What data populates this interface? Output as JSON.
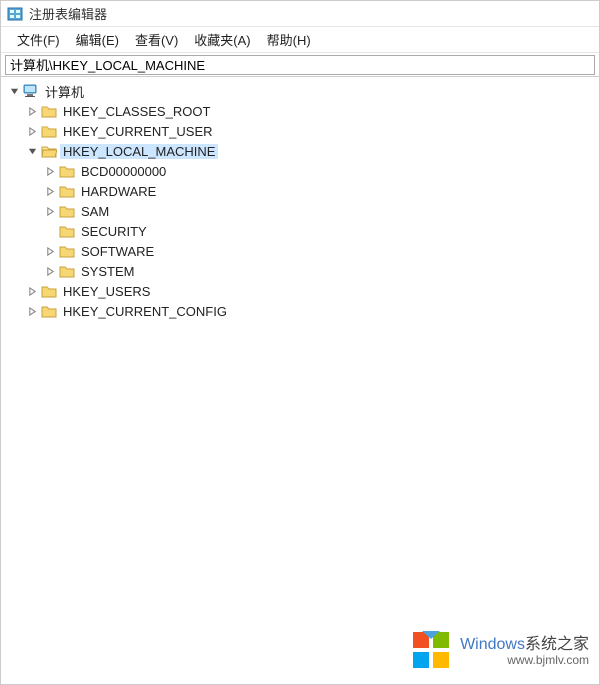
{
  "window": {
    "title": "注册表编辑器"
  },
  "menu": {
    "file": "文件(F)",
    "edit": "编辑(E)",
    "view": "查看(V)",
    "favorites": "收藏夹(A)",
    "help": "帮助(H)"
  },
  "addressbar": {
    "value": "计算机\\HKEY_LOCAL_MACHINE"
  },
  "tree": {
    "root": {
      "label": "计算机"
    },
    "hkcr": {
      "label": "HKEY_CLASSES_ROOT"
    },
    "hkcu": {
      "label": "HKEY_CURRENT_USER"
    },
    "hklm": {
      "label": "HKEY_LOCAL_MACHINE"
    },
    "bcd": {
      "label": "BCD00000000"
    },
    "hardware": {
      "label": "HARDWARE"
    },
    "sam": {
      "label": "SAM"
    },
    "security": {
      "label": "SECURITY"
    },
    "software": {
      "label": "SOFTWARE"
    },
    "system": {
      "label": "SYSTEM"
    },
    "hku": {
      "label": "HKEY_USERS"
    },
    "hkcc": {
      "label": "HKEY_CURRENT_CONFIG"
    }
  },
  "watermark": {
    "brand_en": "Windows",
    "brand_cn": "系统之家",
    "url": "www.bjmlv.com"
  }
}
